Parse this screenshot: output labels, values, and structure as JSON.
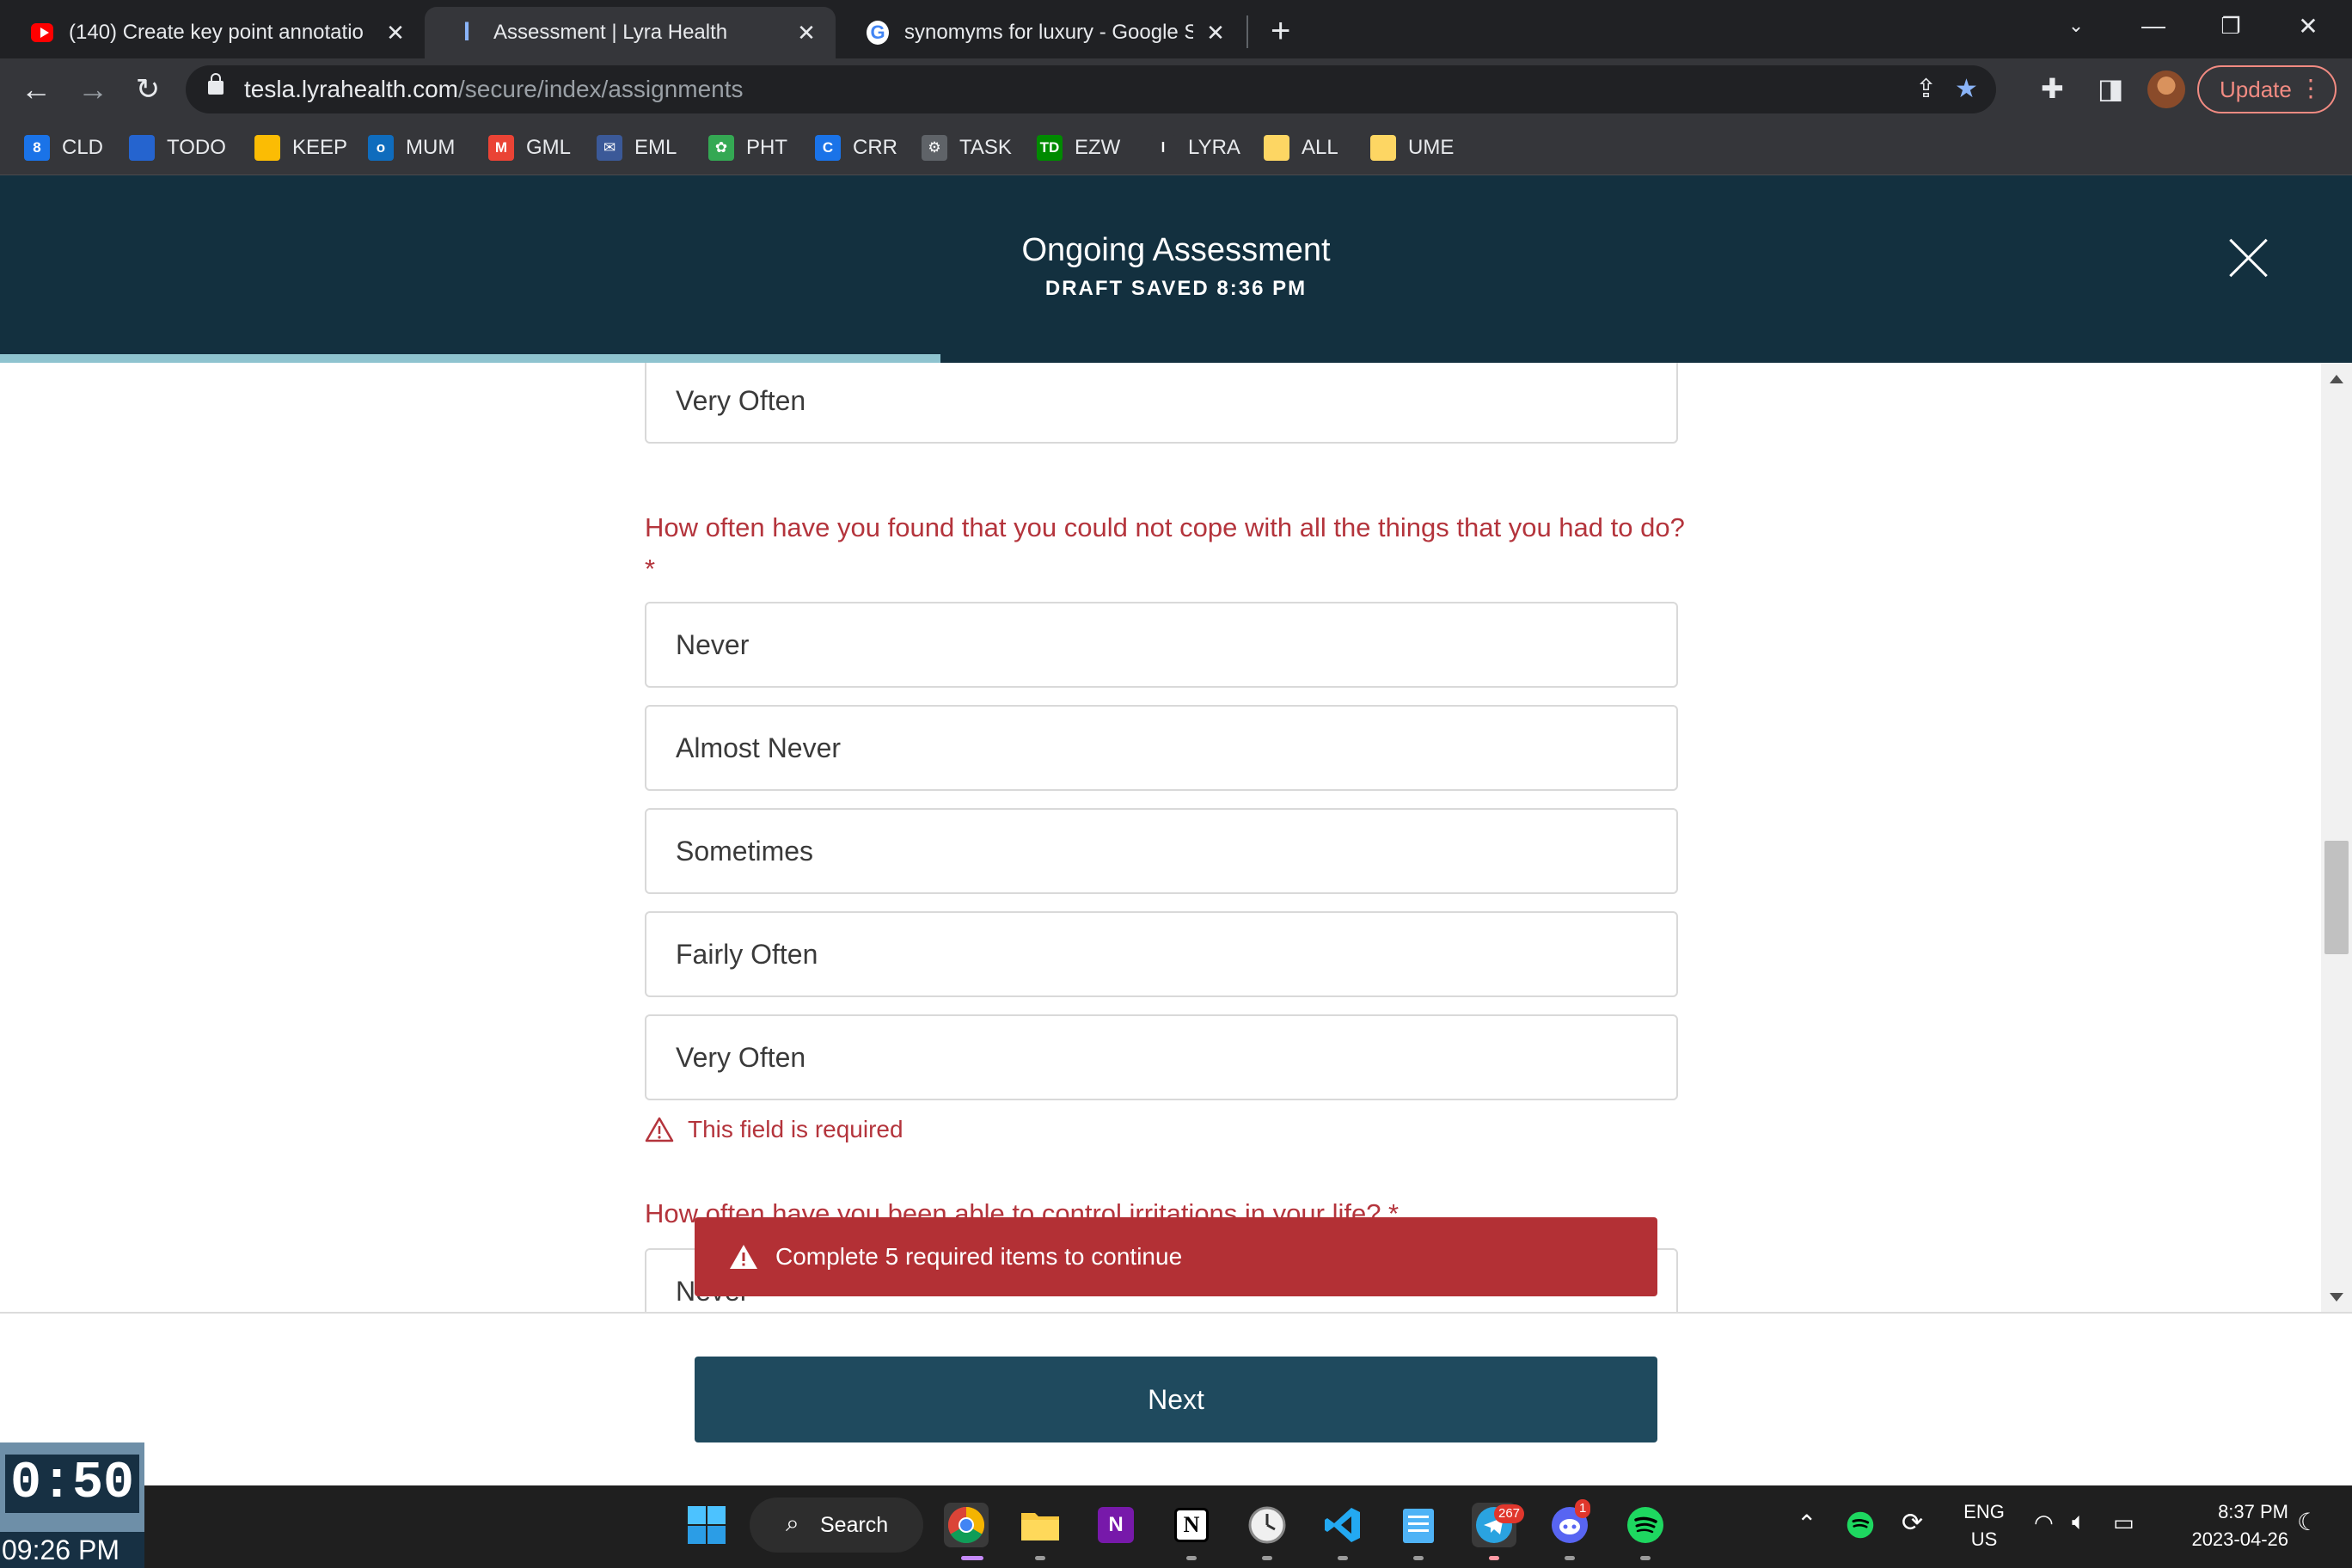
{
  "browser": {
    "tabs": [
      {
        "title": "(140) Create key point annotatio",
        "favicon": "youtube-icon",
        "active": false
      },
      {
        "title": "Assessment | Lyra Health",
        "favicon": "lyra-icon",
        "active": true
      },
      {
        "title": "synomyms for luxury - Google Se",
        "favicon": "google-icon",
        "active": false
      }
    ],
    "url_domain": "tesla.lyrahealth.com",
    "url_path": "/secure/index/assignments",
    "update_label": "Update",
    "bookmarks": [
      {
        "label": "CLD",
        "icon": "calendar-icon",
        "color": "#1a73e8",
        "glyph": "8"
      },
      {
        "label": "TODO",
        "icon": "todo-icon",
        "color": "#2564cf",
        "glyph": ""
      },
      {
        "label": "KEEP",
        "icon": "keep-icon",
        "color": "#fbbc04",
        "glyph": ""
      },
      {
        "label": "MUM",
        "icon": "outlook-icon",
        "color": "#0f6cbd",
        "glyph": "o"
      },
      {
        "label": "GML",
        "icon": "gmail-icon",
        "color": "#ea4335",
        "glyph": "M"
      },
      {
        "label": "EML",
        "icon": "email-icon",
        "color": "#3b5998",
        "glyph": "✉"
      },
      {
        "label": "PHT",
        "icon": "photos-icon",
        "color": "#34a853",
        "glyph": "✿"
      },
      {
        "label": "CRR",
        "icon": "crr-icon",
        "color": "#1a73e8",
        "glyph": "C"
      },
      {
        "label": "TASK",
        "icon": "task-icon",
        "color": "#5f6368",
        "glyph": "⚙"
      },
      {
        "label": "EZW",
        "icon": "td-icon",
        "color": "#008a00",
        "glyph": "TD"
      },
      {
        "label": "LYRA",
        "icon": "lyra-icon",
        "color": "#35363a",
        "glyph": "l"
      },
      {
        "label": "ALL",
        "icon": "note-icon",
        "color": "#fdd663",
        "glyph": ""
      },
      {
        "label": "UME",
        "icon": "note-icon",
        "color": "#fdd663",
        "glyph": ""
      }
    ]
  },
  "header": {
    "title": "Ongoing Assessment",
    "draft_status": "DRAFT SAVED 8:36 PM",
    "progress": 0.4
  },
  "form": {
    "prev_last_option": "Very Often",
    "question": "How often have you found that you could not cope with all the things that you had to do? *",
    "options": [
      "Never",
      "Almost Never",
      "Sometimes",
      "Fairly Often",
      "Very Often"
    ],
    "error": "This field is required",
    "next_question": "How often have you been able to control irritations in your life? *",
    "next_first_option": "Never"
  },
  "toast": {
    "message": "Complete 5 required items to continue"
  },
  "footer": {
    "next_label": "Next"
  },
  "timer": {
    "elapsed": "0:50",
    "clock": "09:26 PM"
  },
  "taskbar": {
    "search_label": "Search",
    "telegram_badge": "267",
    "discord_badge": "1",
    "lang": "ENG",
    "region": "US",
    "time": "8:37 PM",
    "date": "2023-04-26"
  },
  "colors": {
    "header_bg": "#13303f",
    "accent_error": "#b4343c",
    "toast_bg": "#b33035",
    "next_button": "#1f4a5e",
    "progress": "#8ec3cf"
  }
}
